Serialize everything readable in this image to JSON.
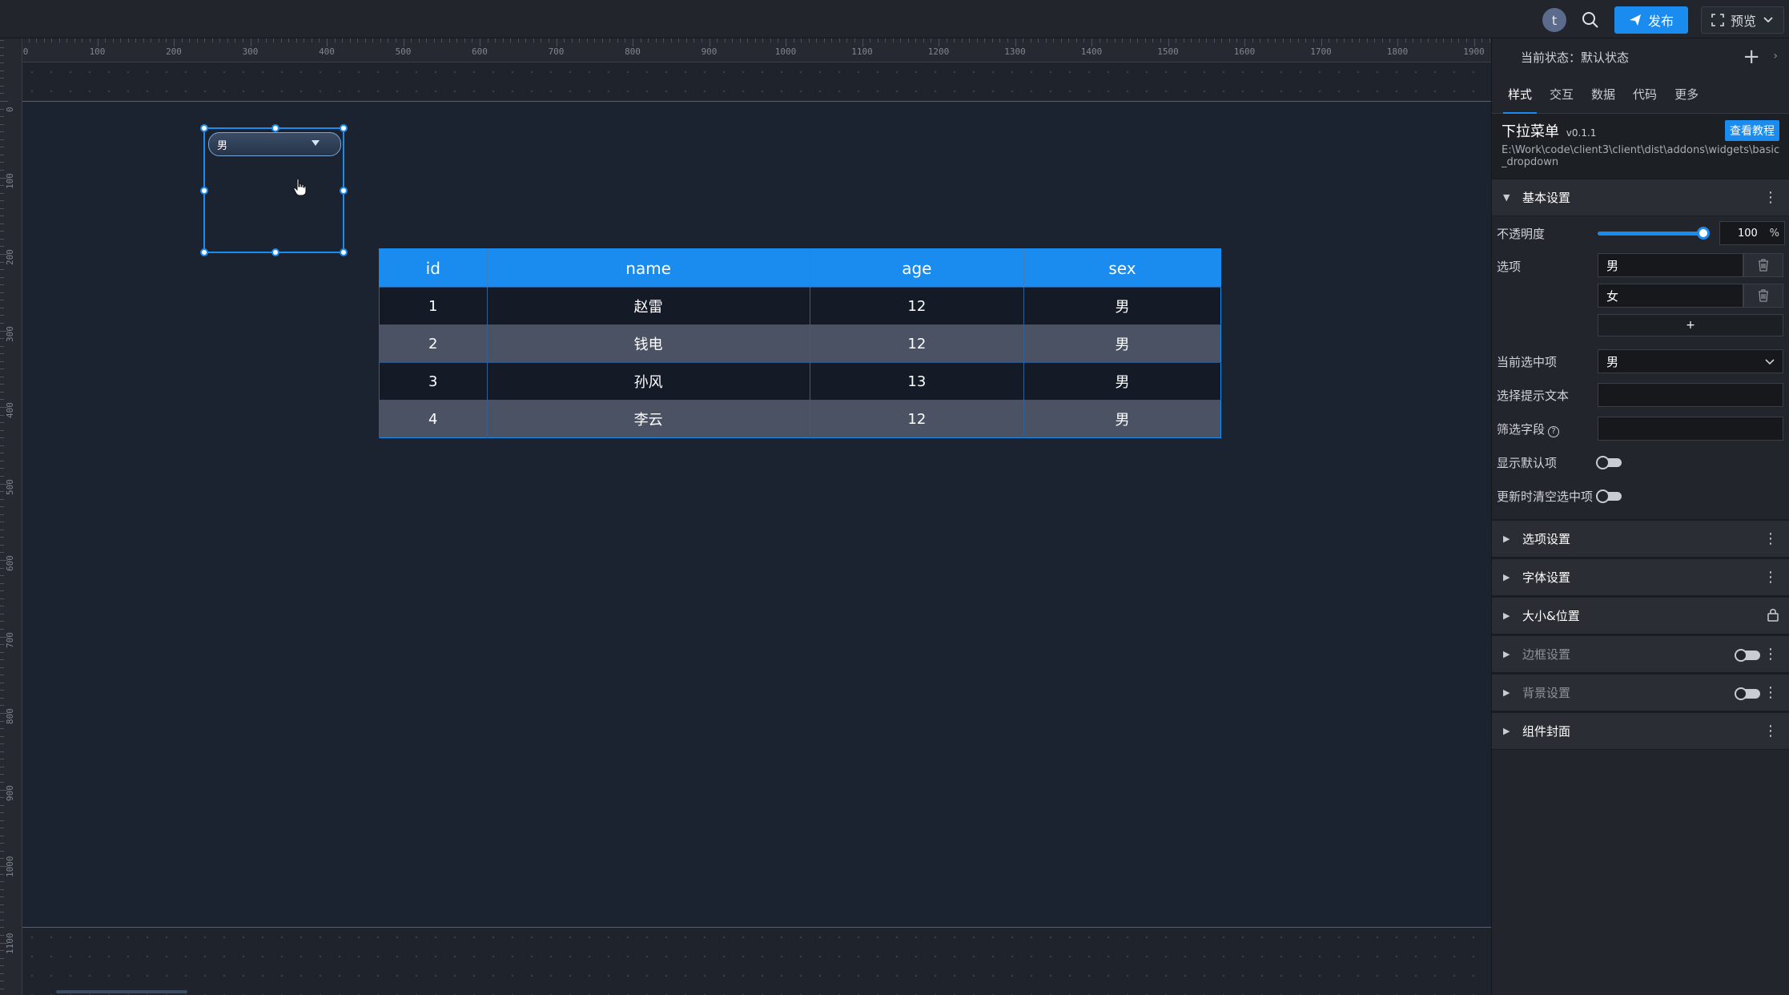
{
  "topbar": {
    "avatar_letter": "t",
    "publish_label": "发布",
    "preview_label": "预览"
  },
  "ruler": {
    "top_marks": [
      "0",
      "100",
      "200",
      "300",
      "400",
      "500",
      "600",
      "700",
      "800",
      "900",
      "1000",
      "1100",
      "1200",
      "1300",
      "1400",
      "1500",
      "1600",
      "1700",
      "1800",
      "1900"
    ],
    "left_marks": [
      "0",
      "100",
      "200",
      "300",
      "400",
      "500",
      "600",
      "700",
      "800",
      "900",
      "1000",
      "1100"
    ]
  },
  "dropdown_widget": {
    "selected": "男"
  },
  "table": {
    "columns": [
      "id",
      "name",
      "age",
      "sex"
    ],
    "rows": [
      [
        "1",
        "赵雷",
        "12",
        "男"
      ],
      [
        "2",
        "钱电",
        "12",
        "男"
      ],
      [
        "3",
        "孙风",
        "13",
        "男"
      ],
      [
        "4",
        "李云",
        "12",
        "男"
      ]
    ]
  },
  "panel": {
    "state_label": "当前状态：默认状态",
    "tabs": [
      "样式",
      "交互",
      "数据",
      "代码",
      "更多"
    ],
    "component": {
      "name": "下拉菜单",
      "version": "v0.1.1",
      "path": "E:\\Work\\code\\client3\\client\\dist\\addons\\widgets\\basic_dropdown",
      "tutorial_label": "查看教程"
    },
    "basic": {
      "title": "基本设置",
      "opacity_label": "不透明度",
      "opacity_value": "100",
      "opacity_unit": "%",
      "options_label": "选项",
      "options": [
        "男",
        "女"
      ],
      "add_option": "+",
      "current_label": "当前选中项",
      "current_value": "男",
      "placeholder_label": "选择提示文本",
      "filter_label": "筛选字段",
      "show_default_label": "显示默认项",
      "clear_on_update_label": "更新时清空选中项"
    },
    "sections": {
      "options_settings": "选项设置",
      "font_settings": "字体设置",
      "size_position": "大小&位置",
      "border_settings": "边框设置",
      "background_settings": "背景设置",
      "cover": "组件封面"
    }
  },
  "colors": {
    "accent": "#1a8cf0",
    "panel_bg": "#22252b",
    "stage_bg": "#1b2230"
  }
}
